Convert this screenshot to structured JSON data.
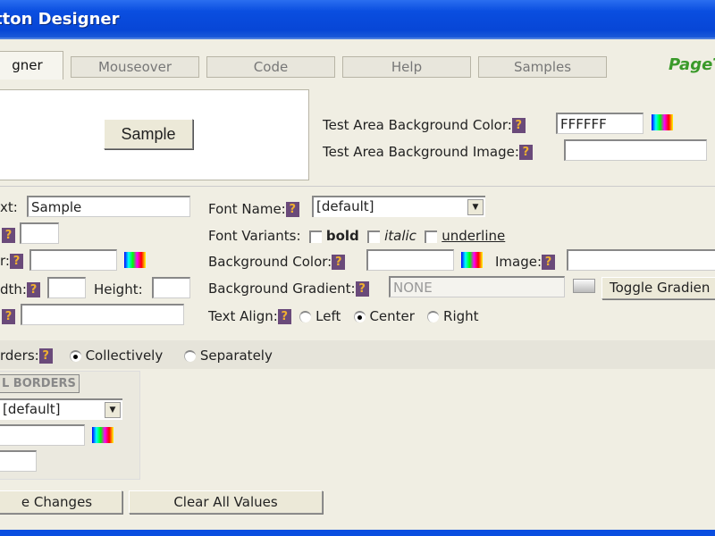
{
  "window": {
    "title": "tton Designer"
  },
  "tabs": [
    "gner",
    "Mouseover",
    "Code",
    "Help",
    "Samples"
  ],
  "logo": "PageT",
  "preview": {
    "sample_button": "Sample"
  },
  "test_area": {
    "bg_color_label": "Test Area Background Color:",
    "bg_color_value": "FFFFFF",
    "bg_image_label": "Test Area Background Image:",
    "bg_image_value": ""
  },
  "left": {
    "text_label": "xt:",
    "text_value": "Sample",
    "width_label": "dth:",
    "height_label": "Height:",
    "r_label": "r:"
  },
  "font": {
    "name_label": "Font Name:",
    "name_value": "[default]",
    "variants_label": "Font Variants:",
    "bold": "bold",
    "italic": "italic",
    "underline": "underline"
  },
  "background": {
    "color_label": "Background Color:",
    "image_label": "Image:",
    "gradient_label": "Background Gradient:",
    "gradient_value": "NONE",
    "toggle_gradient": "Toggle Gradien"
  },
  "align": {
    "label": "Text Align:",
    "options": [
      "Left",
      "Center",
      "Right"
    ],
    "selected": "Center"
  },
  "borders": {
    "label": "rders:",
    "collectively": "Collectively",
    "separately": "Separately",
    "panel_title": "L BORDERS",
    "style_value": "[default]"
  },
  "help_mark": "?",
  "buttons": {
    "save": "e Changes",
    "clear": "Clear All Values"
  }
}
